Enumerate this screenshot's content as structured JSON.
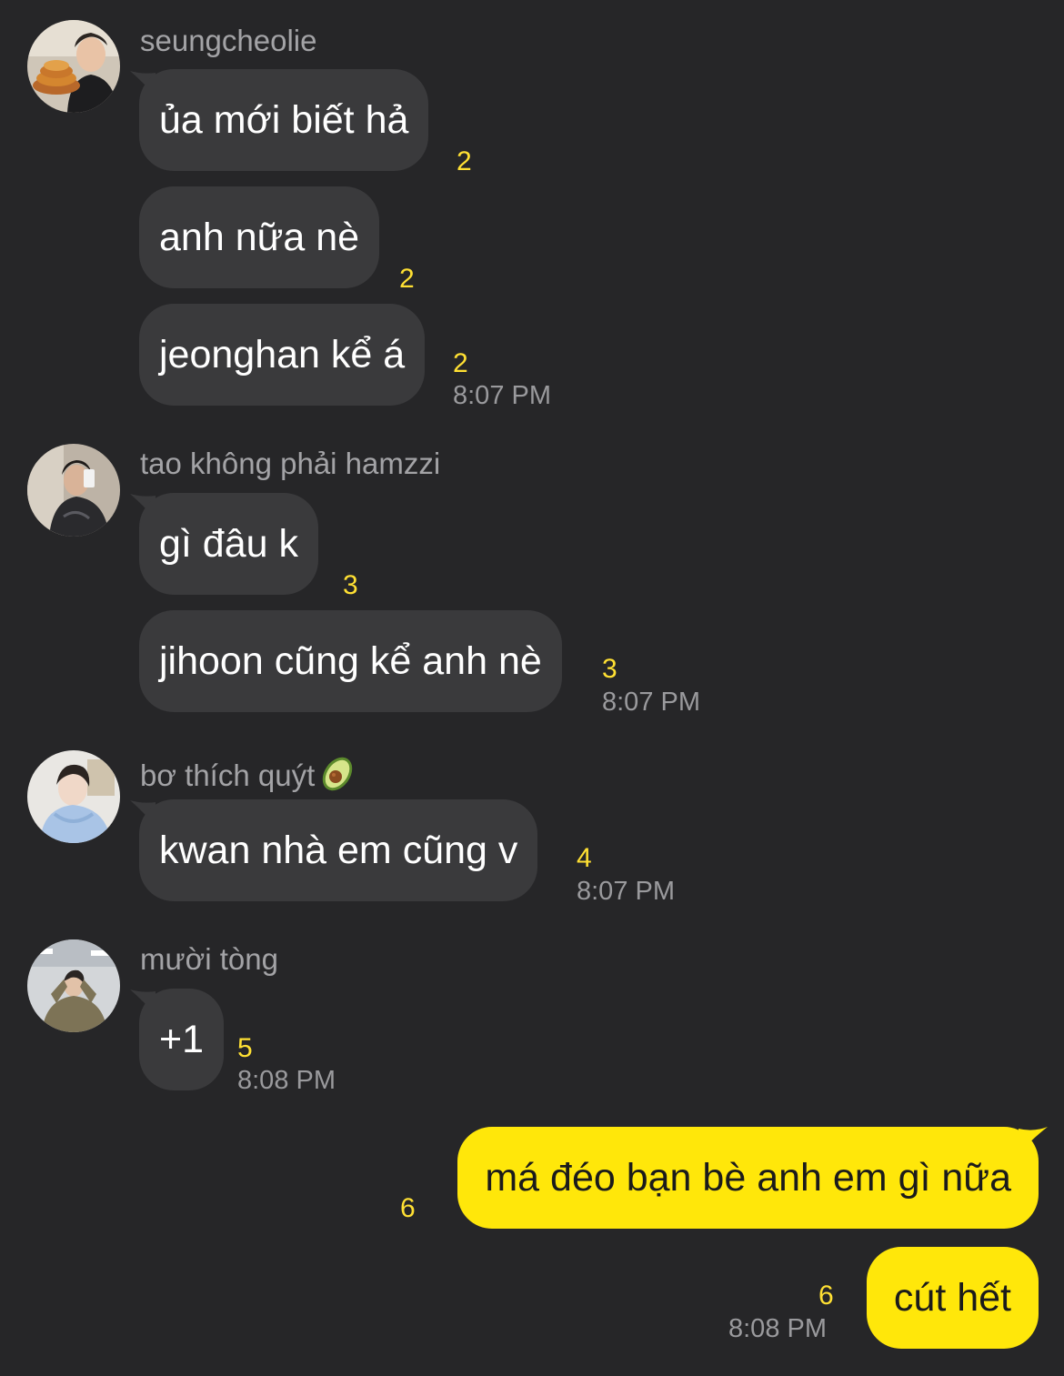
{
  "colors": {
    "background": "#262628",
    "incoming_bubble": "#3a3a3c",
    "outgoing_bubble": "#ffe70a",
    "unread_count": "#ffe033",
    "timestamp": "#9a9a9d",
    "sender_name": "#a3a3a6"
  },
  "groups": [
    {
      "sender": "seungcheolie",
      "avatar_icon": "user-avatar-seungcheolie",
      "messages": [
        {
          "text": "ủa mới biết hả",
          "unread": "2"
        },
        {
          "text": "anh nữa nè",
          "unread": "2"
        },
        {
          "text": "jeonghan kể á",
          "unread": "2",
          "time": "8:07 PM"
        }
      ]
    },
    {
      "sender": "tao không phải hamzzi",
      "avatar_icon": "user-avatar-hamzzi",
      "messages": [
        {
          "text": "gì đâu k",
          "unread": "3"
        },
        {
          "text": "jihoon cũng kể anh nè",
          "unread": "3",
          "time": "8:07 PM"
        }
      ]
    },
    {
      "sender": "bơ thích quýt",
      "sender_emoji": "avocado-emoji",
      "avatar_icon": "user-avatar-bo",
      "messages": [
        {
          "text": "kwan nhà em cũng v",
          "unread": "4",
          "time": "8:07 PM"
        }
      ]
    },
    {
      "sender": "mười tòng",
      "avatar_icon": "user-avatar-muoi-tong",
      "messages": [
        {
          "text": "+1",
          "unread": "5",
          "time": "8:08 PM"
        }
      ]
    }
  ],
  "outgoing": [
    {
      "text": "má đéo bạn bè anh em gì nữa",
      "unread": "6"
    },
    {
      "text": "cút hết",
      "unread": "6",
      "time": "8:08 PM"
    }
  ]
}
